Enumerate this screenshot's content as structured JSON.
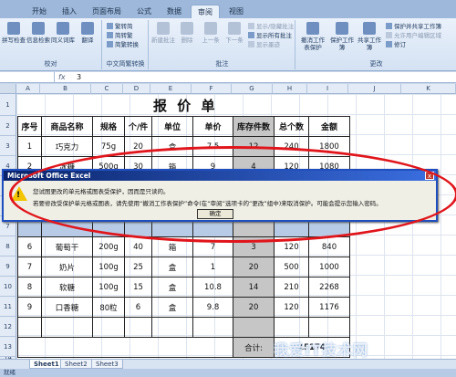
{
  "tabs": [
    "开始",
    "插入",
    "页面布局",
    "公式",
    "数据",
    "审阅",
    "视图"
  ],
  "ribbon": {
    "proofing": {
      "label": "校对",
      "buttons": [
        "拼写检查",
        "信息检索",
        "同义词库",
        "翻译"
      ]
    },
    "chinese": {
      "label": "中文简繁转换",
      "items": [
        "繁转简",
        "简转繁",
        "简繁转换"
      ]
    },
    "comments": {
      "label": "批注",
      "buttons": [
        "新建批注",
        "删除",
        "上一条",
        "下一条"
      ],
      "items": [
        "显示/隐藏批注",
        "显示所有批注",
        "显示墨迹"
      ]
    },
    "changes": {
      "label": "更改",
      "buttons": [
        "撤消工作表保护",
        "保护工作簿",
        "共享工作簿"
      ],
      "items": [
        "保护并共享工作簿",
        "允许用户编辑区域",
        "修订"
      ]
    }
  },
  "formula_bar": {
    "fx": "fx",
    "value": "3"
  },
  "columns": [
    "A",
    "B",
    "C",
    "D",
    "E",
    "F",
    "G",
    "H",
    "I",
    "J",
    "K"
  ],
  "rows": [
    "1",
    "2",
    "3",
    "4",
    "5",
    "6",
    "7",
    "8",
    "9",
    "10",
    "11",
    "12",
    "13",
    "14"
  ],
  "sheet": {
    "title": "报 价 单",
    "headers": [
      "序号",
      "商品名称",
      "规格",
      "个/件",
      "单位",
      "单价",
      "库存件数",
      "总个数",
      "金额"
    ],
    "data": [
      [
        "1",
        "巧克力",
        "75g",
        "20",
        "盒",
        "7.5",
        "12",
        "240",
        "1800"
      ],
      [
        "2",
        "冰糖",
        "500g",
        "30",
        "箱",
        "9",
        "4",
        "120",
        "1080"
      ],
      [
        "6",
        "葡萄干",
        "200g",
        "40",
        "箱",
        "7",
        "3",
        "120",
        "840"
      ],
      [
        "7",
        "奶片",
        "100g",
        "25",
        "盒",
        "1",
        "20",
        "500",
        "1000"
      ],
      [
        "8",
        "软糖",
        "100g",
        "15",
        "盒",
        "10.8",
        "14",
        "210",
        "2268"
      ],
      [
        "9",
        "口香糖",
        "80粒",
        "6",
        "盒",
        "9.8",
        "20",
        "120",
        "1176"
      ]
    ],
    "total_label": "合计:",
    "total_value": "15174"
  },
  "dialog": {
    "title": "Microsoft Office Excel",
    "line1": "您试图更改的单元格或图表受保护，因而是只读的。",
    "line2": "若要修改受保护单元格或图表，请先使用“撤消工作表保护”命令(在“审阅”选项卡的“更改”组中)来取消保护。可能会提示您输入密码。",
    "ok": "确定",
    "close": "x"
  },
  "sheet_tabs": [
    "Sheet1",
    "Sheet2",
    "Sheet3"
  ],
  "status": "就绪",
  "watermark": "我爱IT技术网"
}
